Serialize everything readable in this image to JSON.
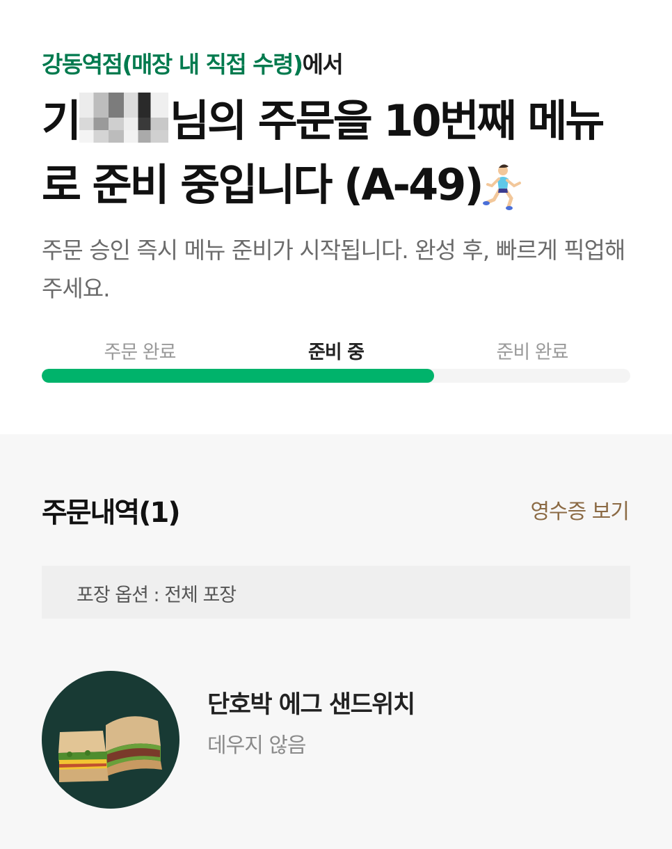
{
  "header": {
    "store": "강동역점(매장 내 직접 수령)",
    "store_suffix": "에서",
    "name_initial": "기",
    "headline_rest": "님의 주문을 10번째 메뉴로 준비 중입니다 (A-49)",
    "emoji": "runner-woman-icon"
  },
  "description": "주문 승인 즉시 메뉴 준비가 시작됩니다. 완성 후, 빠르게 픽업해 주세요.",
  "progress": {
    "steps": [
      "주문 완료",
      "준비 중",
      "준비 완료"
    ],
    "current_step_index": 1,
    "fill_fraction": 0.667,
    "fill_color": "#00b36b"
  },
  "orders": {
    "title": "주문내역(1)",
    "receipt_link": "영수증 보기",
    "packaging": "포장 옵션 : 전체 포장",
    "items": [
      {
        "name": "단호박 에그 샌드위치",
        "option": "데우지 않음",
        "icon": "sandwich-image"
      }
    ]
  },
  "colors": {
    "store_green": "#007a4e",
    "receipt_brown": "#8b6a44",
    "thumb_bg": "#183a34"
  }
}
